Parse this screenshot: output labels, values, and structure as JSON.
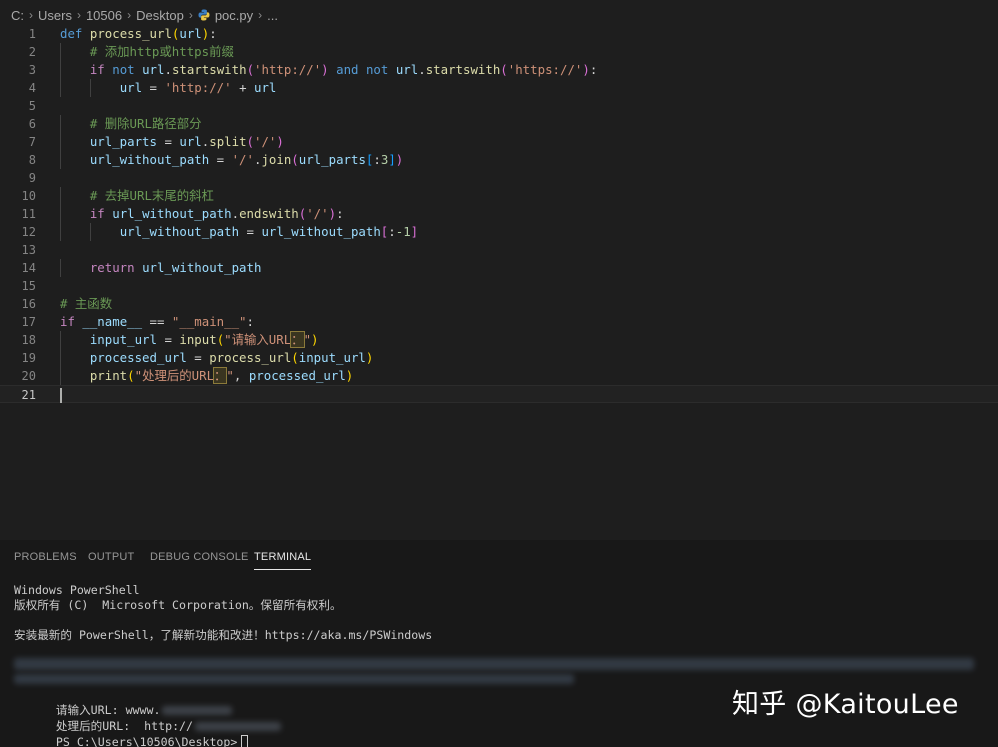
{
  "breadcrumb": {
    "parts": [
      "C:",
      "Users",
      "10506",
      "Desktop",
      "poc.py",
      "..."
    ],
    "file_icon": "python-file-icon"
  },
  "editor": {
    "lines": [
      {
        "n": "1",
        "tokens": [
          [
            "def",
            "k-def"
          ],
          [
            " ",
            ""
          ],
          [
            "process_url",
            "k-fn"
          ],
          [
            "(",
            "k-br1"
          ],
          [
            "url",
            "k-var"
          ],
          [
            ")",
            "k-br1"
          ],
          [
            ":",
            "k-op"
          ]
        ]
      },
      {
        "n": "2",
        "tokens": [
          [
            "    ",
            ""
          ],
          [
            "# 添加http或https前缀",
            "k-com"
          ]
        ]
      },
      {
        "n": "3",
        "tokens": [
          [
            "    ",
            ""
          ],
          [
            "if",
            "k-ctrl"
          ],
          [
            " ",
            ""
          ],
          [
            "not",
            "k-def"
          ],
          [
            " ",
            ""
          ],
          [
            "url",
            "k-var"
          ],
          [
            ".",
            "k-op"
          ],
          [
            "startswith",
            "k-fn"
          ],
          [
            "(",
            "k-br2"
          ],
          [
            "'http://'",
            "k-str"
          ],
          [
            ")",
            "k-br2"
          ],
          [
            " ",
            ""
          ],
          [
            "and",
            "k-def"
          ],
          [
            " ",
            ""
          ],
          [
            "not",
            "k-def"
          ],
          [
            " ",
            ""
          ],
          [
            "url",
            "k-var"
          ],
          [
            ".",
            "k-op"
          ],
          [
            "startswith",
            "k-fn"
          ],
          [
            "(",
            "k-br2"
          ],
          [
            "'https://'",
            "k-str"
          ],
          [
            ")",
            "k-br2"
          ],
          [
            ":",
            "k-op"
          ]
        ]
      },
      {
        "n": "4",
        "tokens": [
          [
            "        ",
            ""
          ],
          [
            "url",
            "k-var"
          ],
          [
            " = ",
            "k-op"
          ],
          [
            "'http://'",
            "k-str"
          ],
          [
            " + ",
            "k-op"
          ],
          [
            "url",
            "k-var"
          ]
        ]
      },
      {
        "n": "5",
        "tokens": []
      },
      {
        "n": "6",
        "tokens": [
          [
            "    ",
            ""
          ],
          [
            "# 删除URL路径部分",
            "k-com"
          ]
        ]
      },
      {
        "n": "7",
        "tokens": [
          [
            "    ",
            ""
          ],
          [
            "url_parts",
            "k-var"
          ],
          [
            " = ",
            "k-op"
          ],
          [
            "url",
            "k-var"
          ],
          [
            ".",
            "k-op"
          ],
          [
            "split",
            "k-fn"
          ],
          [
            "(",
            "k-br2"
          ],
          [
            "'/'",
            "k-str"
          ],
          [
            ")",
            "k-br2"
          ]
        ]
      },
      {
        "n": "8",
        "tokens": [
          [
            "    ",
            ""
          ],
          [
            "url_without_path",
            "k-var"
          ],
          [
            " = ",
            "k-op"
          ],
          [
            "'/'",
            "k-str"
          ],
          [
            ".",
            "k-op"
          ],
          [
            "join",
            "k-fn"
          ],
          [
            "(",
            "k-br2"
          ],
          [
            "url_parts",
            "k-var"
          ],
          [
            "[",
            "k-br3"
          ],
          [
            ":",
            "k-op"
          ],
          [
            "3",
            "k-num"
          ],
          [
            "]",
            "k-br3"
          ],
          [
            ")",
            "k-br2"
          ]
        ]
      },
      {
        "n": "9",
        "tokens": []
      },
      {
        "n": "10",
        "tokens": [
          [
            "    ",
            ""
          ],
          [
            "# 去掉URL末尾的斜杠",
            "k-com"
          ]
        ]
      },
      {
        "n": "11",
        "tokens": [
          [
            "    ",
            ""
          ],
          [
            "if",
            "k-ctrl"
          ],
          [
            " ",
            ""
          ],
          [
            "url_without_path",
            "k-var"
          ],
          [
            ".",
            "k-op"
          ],
          [
            "endswith",
            "k-fn"
          ],
          [
            "(",
            "k-br2"
          ],
          [
            "'/'",
            "k-str"
          ],
          [
            ")",
            "k-br2"
          ],
          [
            ":",
            "k-op"
          ]
        ]
      },
      {
        "n": "12",
        "tokens": [
          [
            "        ",
            ""
          ],
          [
            "url_without_path",
            "k-var"
          ],
          [
            " = ",
            "k-op"
          ],
          [
            "url_without_path",
            "k-var"
          ],
          [
            "[",
            "k-br2"
          ],
          [
            ":",
            "k-op"
          ],
          [
            "-1",
            "k-num"
          ],
          [
            "]",
            "k-br2"
          ]
        ]
      },
      {
        "n": "13",
        "tokens": []
      },
      {
        "n": "14",
        "tokens": [
          [
            "    ",
            ""
          ],
          [
            "return",
            "k-ctrl"
          ],
          [
            " ",
            ""
          ],
          [
            "url_without_path",
            "k-var"
          ]
        ]
      },
      {
        "n": "15",
        "tokens": []
      },
      {
        "n": "16",
        "tokens": [
          [
            "# 主函数",
            "k-com"
          ]
        ]
      },
      {
        "n": "17",
        "tokens": [
          [
            "if",
            "k-ctrl"
          ],
          [
            " ",
            ""
          ],
          [
            "__name__",
            "k-var"
          ],
          [
            " == ",
            "k-op"
          ],
          [
            "\"__main__\"",
            "k-str"
          ],
          [
            ":",
            "k-op"
          ]
        ]
      },
      {
        "n": "18",
        "tokens": [
          [
            "    ",
            ""
          ],
          [
            "input_url",
            "k-var"
          ],
          [
            " = ",
            "k-op"
          ],
          [
            "input",
            "k-fn"
          ],
          [
            "(",
            "k-br1"
          ],
          [
            "\"请输入URL",
            "k-str"
          ],
          [
            "：",
            "k-str fullw"
          ],
          [
            "\"",
            "k-str"
          ],
          [
            ")",
            "k-br1"
          ]
        ]
      },
      {
        "n": "19",
        "tokens": [
          [
            "    ",
            ""
          ],
          [
            "processed_url",
            "k-var"
          ],
          [
            " = ",
            "k-op"
          ],
          [
            "process_url",
            "k-fn"
          ],
          [
            "(",
            "k-br1"
          ],
          [
            "input_url",
            "k-var"
          ],
          [
            ")",
            "k-br1"
          ]
        ]
      },
      {
        "n": "20",
        "tokens": [
          [
            "    ",
            ""
          ],
          [
            "print",
            "k-fn"
          ],
          [
            "(",
            "k-br1"
          ],
          [
            "\"处理后的URL",
            "k-str"
          ],
          [
            "：",
            "k-str fullw"
          ],
          [
            "\"",
            "k-str"
          ],
          [
            ", ",
            "k-op"
          ],
          [
            "processed_url",
            "k-var"
          ],
          [
            ")",
            "k-br1"
          ]
        ]
      },
      {
        "n": "21",
        "tokens": []
      }
    ]
  },
  "panel": {
    "tabs": [
      "PROBLEMS",
      "OUTPUT",
      "DEBUG CONSOLE",
      "TERMINAL"
    ],
    "active_tab": "TERMINAL",
    "terminal": {
      "header_line1": "Windows PowerShell",
      "header_line2": "版权所有 (C)  Microsoft Corporation。保留所有权利。",
      "header_line3": "安装最新的 PowerShell，了解新功能和改进！https://aka.ms/PSWindows",
      "input_prompt": "请输入URL: wwww.",
      "output_prefix": "处理后的URL:  http://",
      "ps_prompt": "PS C:\\Users\\10506\\Desktop>"
    }
  },
  "watermark": {
    "text": "知乎 @KaitouLee"
  },
  "colors": {
    "background": "#1e1e1e",
    "keyword": "#569cd6",
    "control": "#c586c0",
    "function": "#dcdcaa",
    "variable": "#9cdcfe",
    "string": "#ce9178",
    "comment": "#6a9955"
  }
}
